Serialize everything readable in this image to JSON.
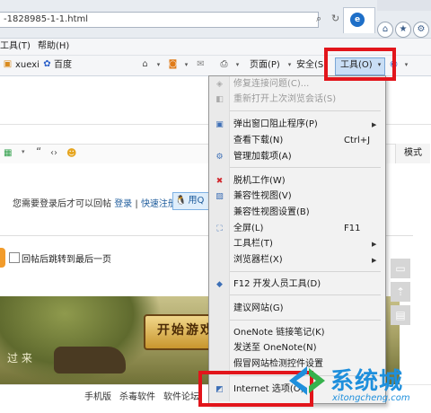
{
  "address_bar": {
    "url": "-1828985-1-1.html"
  },
  "window_buttons": {
    "home": "⌂",
    "favorites": "★",
    "settings": "⚙"
  },
  "menubar": {
    "tools": "工具(T)",
    "help": "帮助(H)"
  },
  "favorites_bar": {
    "link1": "xuexi",
    "link2": "百度"
  },
  "command_bar": {
    "page": "页面(P)",
    "safety": "安全(S)",
    "tools": "工具(O)"
  },
  "page": {
    "login_text": "您需要登录后才可以回帖",
    "login_link": "登录",
    "separator": "|",
    "register_link": "快速注册",
    "qq_button": "用Q",
    "jump_label": "回帖后跳转到最后一页",
    "mode_tab": "模式",
    "banner_button": "开始游戏",
    "banner_side_text": "过 来",
    "footer_links": [
      "手机版",
      "杀毒软件",
      "软件论坛"
    ]
  },
  "tools_menu": {
    "items": [
      {
        "label": "修复连接问题(C)...",
        "disabled": true
      },
      {
        "label": "重新打开上次浏览会话(S)",
        "disabled": true
      },
      {
        "label": "弹出窗口阻止程序(P)",
        "submenu": true
      },
      {
        "label": "查看下载(N)",
        "shortcut": "Ctrl+J"
      },
      {
        "label": "管理加载项(A)"
      },
      {
        "label": "脱机工作(W)"
      },
      {
        "label": "兼容性视图(V)"
      },
      {
        "label": "兼容性视图设置(B)"
      },
      {
        "label": "全屏(L)",
        "shortcut": "F11"
      },
      {
        "label": "工具栏(T)",
        "submenu": true
      },
      {
        "label": "浏览器栏(X)",
        "submenu": true
      },
      {
        "label": "F12 开发人员工具(D)"
      },
      {
        "label": "建议网站(G)"
      },
      {
        "label": "OneNote 链接笔记(K)"
      },
      {
        "label": "发送至 OneNote(N)"
      },
      {
        "label": "假冒网站检测控件设置"
      },
      {
        "label": "Internet 选项(O)"
      }
    ]
  },
  "watermark": {
    "brand": "系统城",
    "url": "xitongcheng.com"
  },
  "colors": {
    "highlight_box": "#e2151b",
    "menu_bg": "#f2f2f2",
    "accent": "#1e8fdc"
  }
}
